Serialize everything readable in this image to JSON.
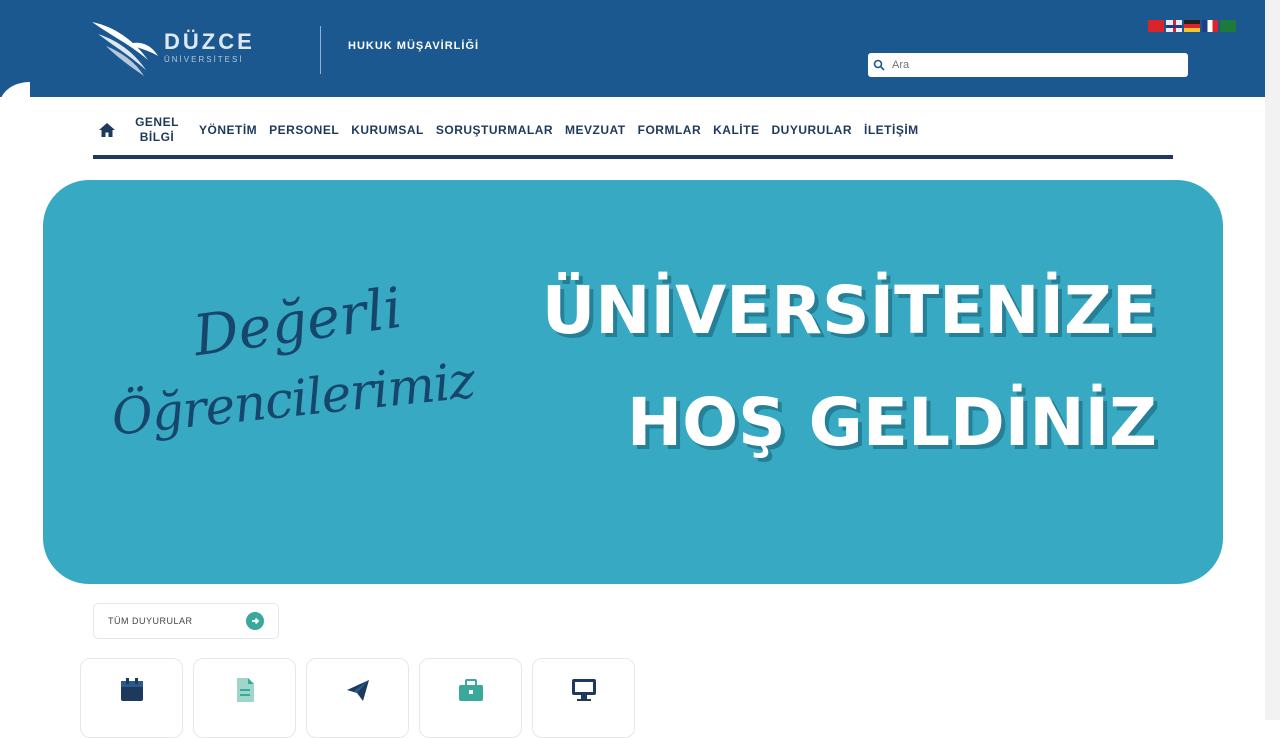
{
  "header": {
    "logo_title": "DÜZCE",
    "logo_subtitle": "ÜNİVERSİTESİ",
    "department": "HUKUK MÜŞAVİRLİĞİ",
    "search_placeholder": "Ara",
    "flags": [
      "tr-flag",
      "gb-flag",
      "de-flag",
      "fr-flag",
      "sa-flag"
    ]
  },
  "nav": {
    "home_icon": "home-icon",
    "items": [
      {
        "label": "GENEL BİLGİ"
      },
      {
        "label": "YÖNETİM"
      },
      {
        "label": "PERSONEL"
      },
      {
        "label": "KURUMSAL"
      },
      {
        "label": "SORUŞTURMALAR"
      },
      {
        "label": "MEVZUAT"
      },
      {
        "label": "FORMLAR"
      },
      {
        "label": "KALİTE"
      },
      {
        "label": "DUYURULAR"
      },
      {
        "label": "İLETİŞİM"
      }
    ]
  },
  "banner": {
    "script_line1": "Değerli",
    "script_line2": "Öğrencilerimiz",
    "headline_line1": "ÜNİVERSİTENİZE",
    "headline_line2": "HOŞ GELDİNİZ"
  },
  "links": {
    "all_label": "TÜM DUYURULAR"
  },
  "cards": [
    {
      "icon": "calendar-icon"
    },
    {
      "icon": "document-icon"
    },
    {
      "icon": "send-icon"
    },
    {
      "icon": "briefcase-icon"
    },
    {
      "icon": "monitor-icon"
    }
  ],
  "colors": {
    "header_bg": "#1b5890",
    "nav_text": "#1d3a5c",
    "banner_bg": "#38a9c3",
    "script_text": "#16466b",
    "card_icon": "#1d3a5c",
    "accent_teal": "#3aa89a"
  }
}
